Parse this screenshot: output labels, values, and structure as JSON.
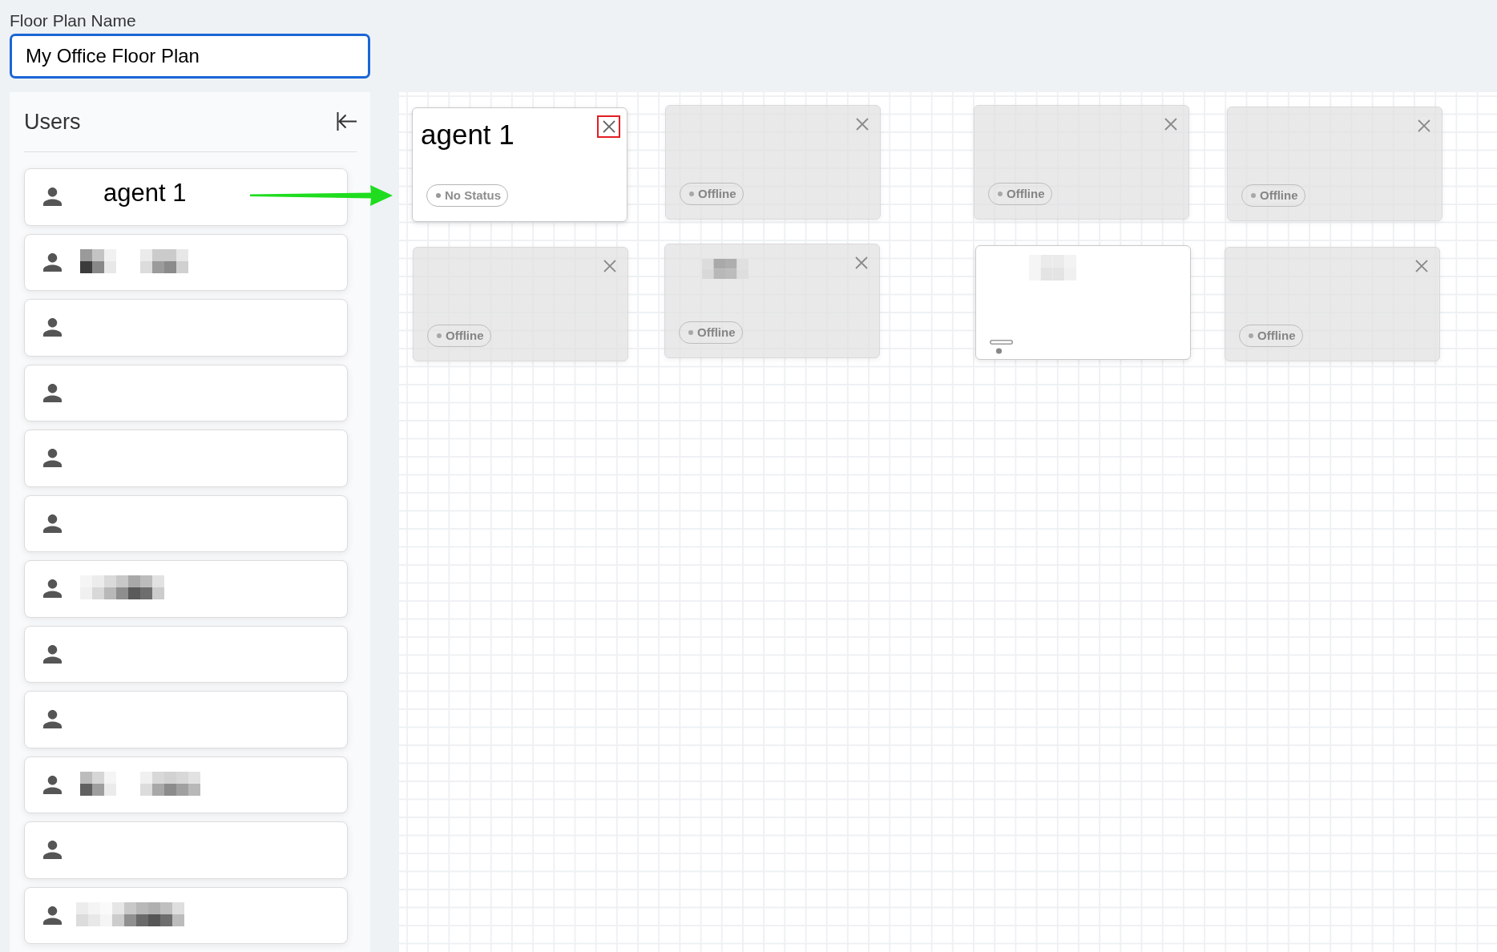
{
  "floor_plan_name": {
    "label": "Floor Plan Name",
    "value": "My Office Floor Plan"
  },
  "users_panel": {
    "title": "Users",
    "users": [
      {
        "kind": "named",
        "name": "agent 1"
      },
      {
        "kind": "pixelated"
      },
      {
        "kind": "blank"
      },
      {
        "kind": "blank"
      },
      {
        "kind": "blank"
      },
      {
        "kind": "blank"
      },
      {
        "kind": "pixelated"
      },
      {
        "kind": "blank"
      },
      {
        "kind": "blank"
      },
      {
        "kind": "pixelated"
      },
      {
        "kind": "blank"
      },
      {
        "kind": "pixelated"
      }
    ]
  },
  "canvas": {
    "cards": [
      {
        "kind": "agent",
        "name": "agent 1",
        "status": "No Status",
        "close_highlighted": true
      },
      {
        "kind": "offline",
        "name_pixelated": false,
        "status": "Offline",
        "close_highlighted": false
      },
      {
        "kind": "offline",
        "name_pixelated": false,
        "status": "Offline",
        "close_highlighted": false
      },
      {
        "kind": "offline",
        "name_pixelated": false,
        "status": "Offline",
        "close_highlighted": false
      },
      {
        "kind": "offline",
        "name_pixelated": false,
        "status": "Offline",
        "close_highlighted": false
      },
      {
        "kind": "offline",
        "name_pixelated": true,
        "status": "Offline",
        "close_highlighted": false
      },
      {
        "kind": "placeholder",
        "name_pixelated": true
      },
      {
        "kind": "offline",
        "name_pixelated": false,
        "status": "Offline",
        "close_highlighted": false
      }
    ]
  }
}
